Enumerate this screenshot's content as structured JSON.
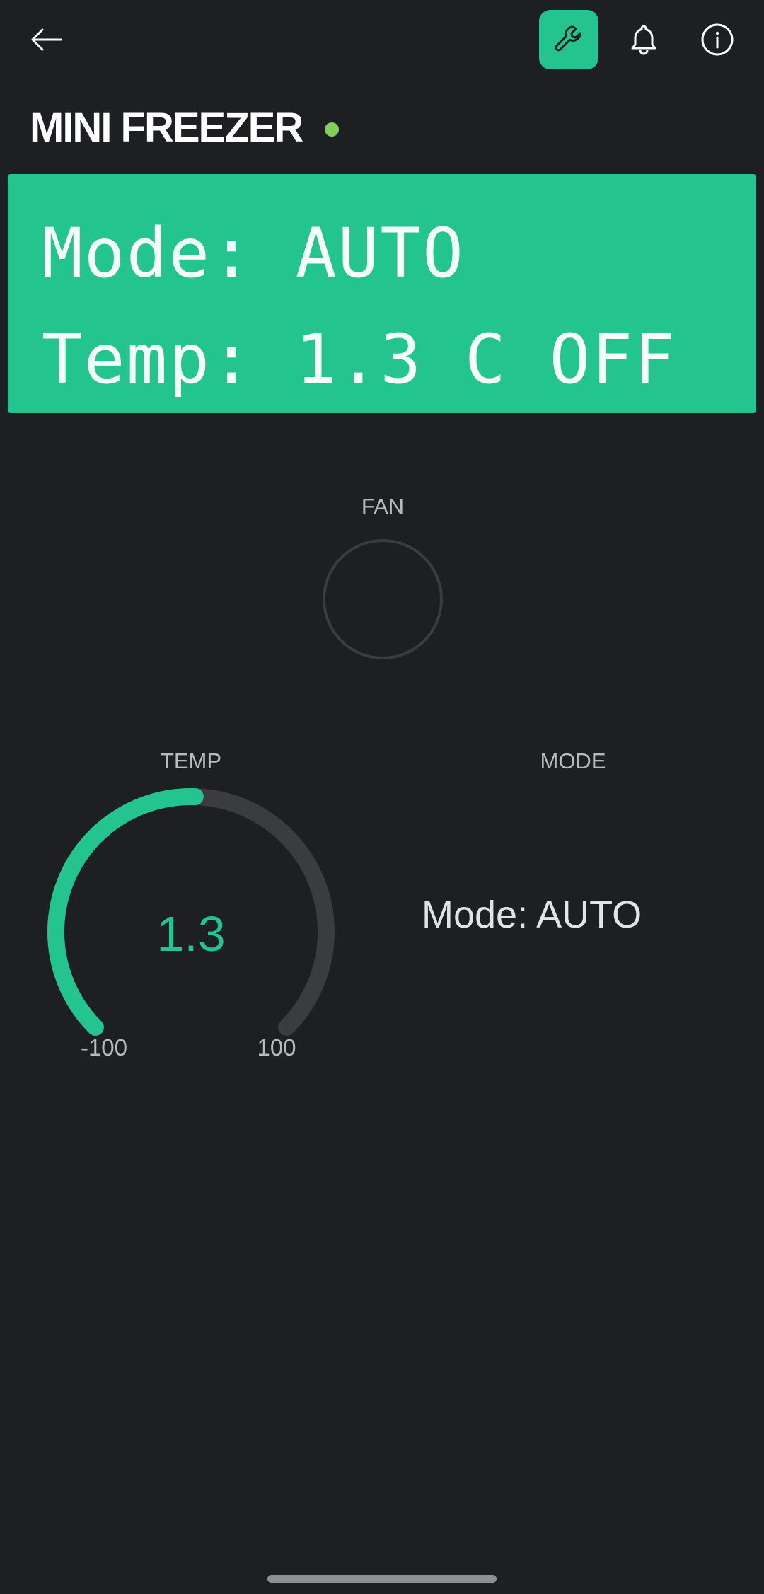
{
  "header": {
    "title": "MINI FREEZER",
    "back_icon": "arrow-left-icon",
    "actions": [
      {
        "icon": "wrench-icon",
        "active": true,
        "color": "#23c48e"
      },
      {
        "icon": "bell-icon"
      },
      {
        "icon": "info-icon"
      }
    ],
    "status_color": "#7ed05a"
  },
  "lcd": {
    "line1": "Mode: AUTO",
    "line2": "Temp: 1.3 C OFF",
    "background": "#23c48e"
  },
  "fan": {
    "label": "FAN",
    "state": "off"
  },
  "temp_gauge": {
    "label": "TEMP",
    "value": 1.3,
    "display_value": "1.3",
    "min": -100,
    "max": 100,
    "min_label": "-100",
    "max_label": "100",
    "color": "#23c48e",
    "track_color": "#3b3c40"
  },
  "mode_widget": {
    "label": "MODE",
    "value": "Mode: AUTO"
  }
}
